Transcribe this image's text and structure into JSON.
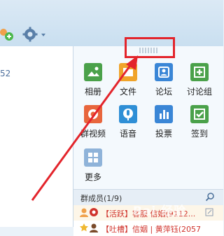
{
  "toolbar": {
    "people_icon": "people-add-icon",
    "gear_icon": "gear-icon",
    "caret_icon": "caret-down-icon"
  },
  "left_pane": {
    "fragment_text": "52"
  },
  "apps": [
    {
      "label": "相册",
      "icon": "photo-album-icon",
      "color": "#4aa14a"
    },
    {
      "label": "文件",
      "icon": "folder-icon",
      "color": "#f0a42a"
    },
    {
      "label": "论坛",
      "icon": "forum-icon",
      "color": "#3a86d6"
    },
    {
      "label": "讨论组",
      "icon": "discussion-group-icon",
      "color": "#4aa14a"
    },
    {
      "label": "群视频",
      "icon": "group-video-icon",
      "color": "#e8663d"
    },
    {
      "label": "语音",
      "icon": "voice-icon",
      "color": "#2f8fd6"
    },
    {
      "label": "投票",
      "icon": "vote-icon",
      "color": "#3a86d6"
    },
    {
      "label": "签到",
      "icon": "checkin-icon",
      "color": "#4aa14a"
    },
    {
      "label": "更多",
      "icon": "more-grid-icon",
      "color": "#8fb3d9"
    }
  ],
  "members": {
    "title": "群成员(1/9)",
    "rows": [
      {
        "tag": "【活跃】",
        "name": "客服 信姻(9112...",
        "color": "#d0332c"
      },
      {
        "tag": "【吐槽】",
        "name": "信姻 | 黄萍钰(2057",
        "color": "#d0332c"
      }
    ]
  },
  "colors": {
    "highlight": "#e3242b",
    "panel_bg": "#f4f9fd"
  }
}
